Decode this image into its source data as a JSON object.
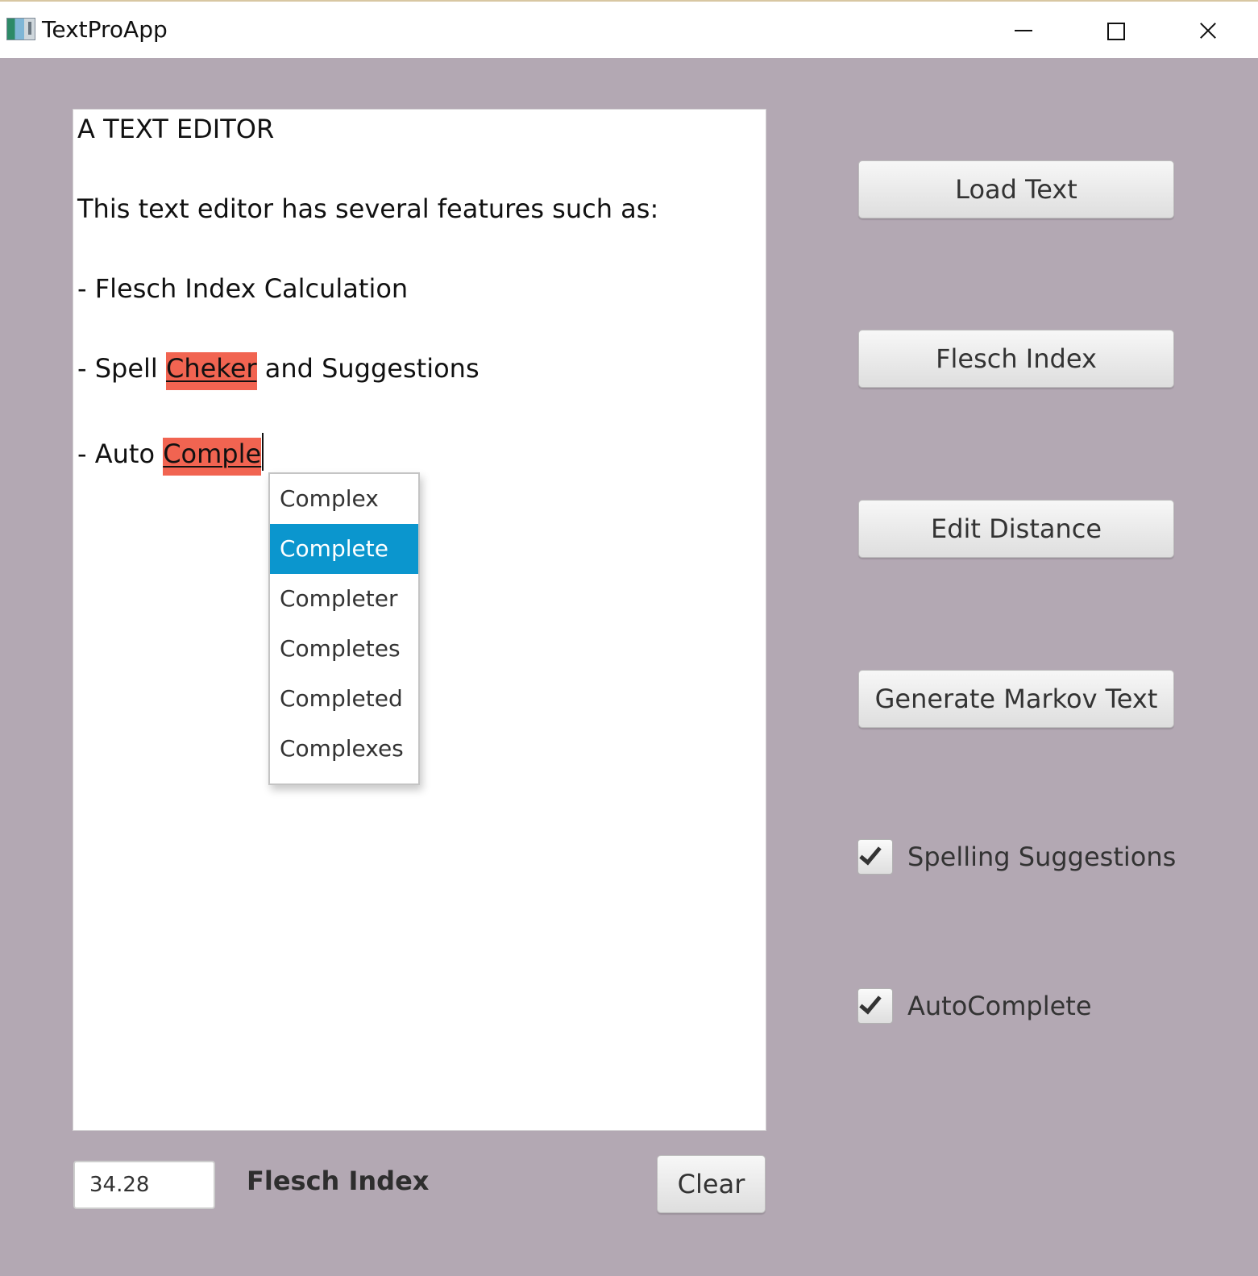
{
  "window": {
    "title": "TextProApp",
    "icon": "app-icon",
    "controls": {
      "minimize_icon": "minimize-icon",
      "maximize_icon": "maximize-icon",
      "close_icon": "close-icon"
    }
  },
  "colors": {
    "background": "#b3a8b3",
    "misspelled_highlight": "#f16451",
    "selected_suggestion": "#0b96ce"
  },
  "editor": {
    "lines": [
      {
        "text": "A TEXT EDITOR"
      },
      {
        "text": "This text editor has several features such as:"
      },
      {
        "text": "- Flesch Index Calculation"
      },
      {
        "prefix": "- Spell ",
        "misspelled": "Cheker",
        "suffix": " and Suggestions"
      },
      {
        "prefix": "- Auto ",
        "misspelled": "Comple",
        "suffix": ""
      }
    ]
  },
  "autocomplete": {
    "items": [
      "Complex",
      "Complete",
      "Completer",
      "Completes",
      "Completed",
      "Complexes"
    ],
    "selected": "Complete"
  },
  "actions": {
    "load_text": "Load Text",
    "flesch_index": "Flesch Index",
    "edit_distance": "Edit Distance",
    "generate_markov": "Generate Markov Text"
  },
  "options": {
    "spelling_suggestions": {
      "label": "Spelling Suggestions",
      "checked": true
    },
    "autocomplete": {
      "label": "AutoComplete",
      "checked": true
    }
  },
  "footer": {
    "flesch_value": "34.28",
    "flesch_label": "Flesch Index",
    "clear_label": "Clear"
  }
}
